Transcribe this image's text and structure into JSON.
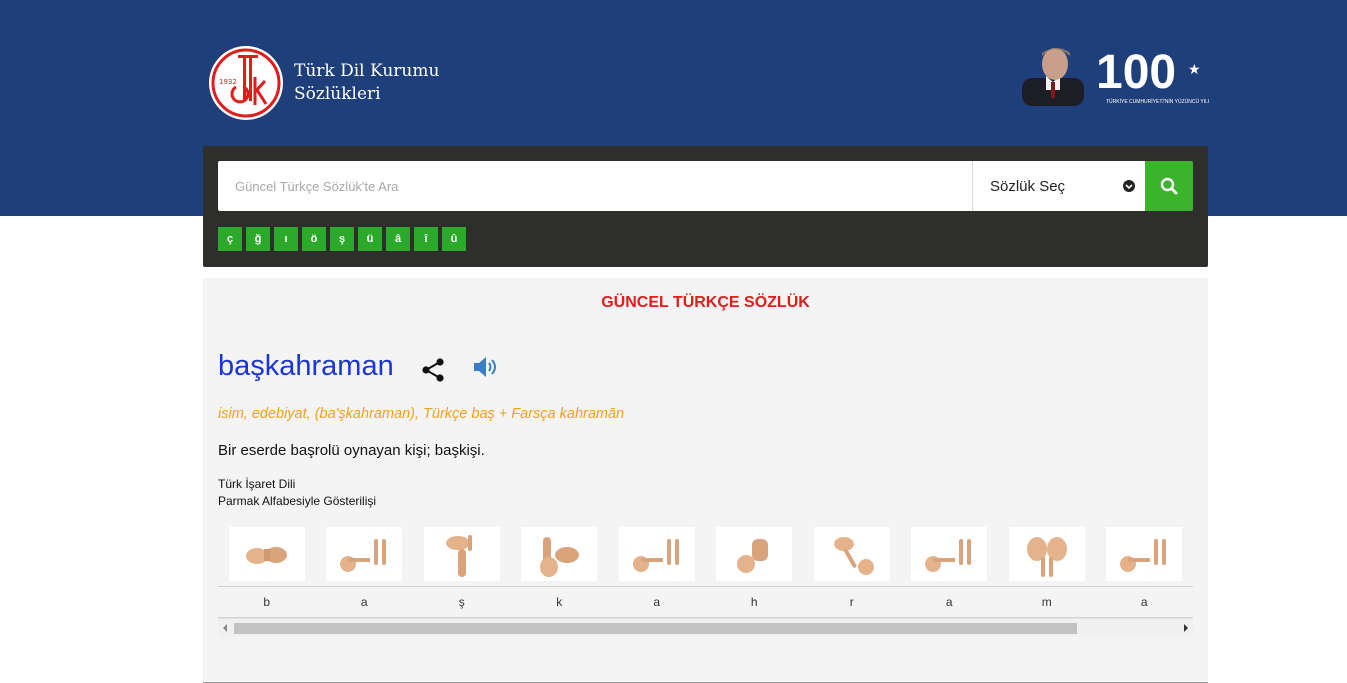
{
  "header": {
    "logo_year": "1932",
    "logo_letters": "TDK",
    "title_line1": "Türk Dil Kurumu",
    "title_line2": "Sözlükleri",
    "centennial_number": "100",
    "centennial_caption": "TÜRKİYE CUMHURİYETİ'NİN YÜZÜNCÜ YILI"
  },
  "search": {
    "placeholder": "Güncel Türkçe Sözlük'te Ara",
    "value": "",
    "dictionary_select": "Sözlük Seç",
    "special_chars": [
      "ç",
      "ğ",
      "ı",
      "ö",
      "ş",
      "ü",
      "â",
      "î",
      "û"
    ]
  },
  "entry": {
    "dictionary_title": "GÜNCEL TÜRKÇE SÖZLÜK",
    "headword": "başkahraman",
    "grammar": "isim, edebiyat, (ba'şkahraman), Türkçe baş + Farsça kahramān",
    "meaning": "Bir eserde başrolü oynayan kişi; başkişi.",
    "sign_language_title": "Türk İşaret Dili",
    "sign_language_subtitle": "Parmak Alfabesiyle Gösterilişi",
    "letters": [
      "b",
      "a",
      "ş",
      "k",
      "a",
      "h",
      "r",
      "a",
      "m",
      "a"
    ]
  },
  "colors": {
    "header_bg": "#1f3f7a",
    "panel_bg": "#2e2f2a",
    "accent_green": "#3bb42b",
    "title_red": "#e21b1b",
    "headword_blue": "#1a35d8",
    "grammar_orange": "#f3a11b"
  },
  "icons": {
    "search": "search-icon",
    "select": "chevron-down-icon",
    "share": "share-icon",
    "sound": "speaker-icon"
  }
}
